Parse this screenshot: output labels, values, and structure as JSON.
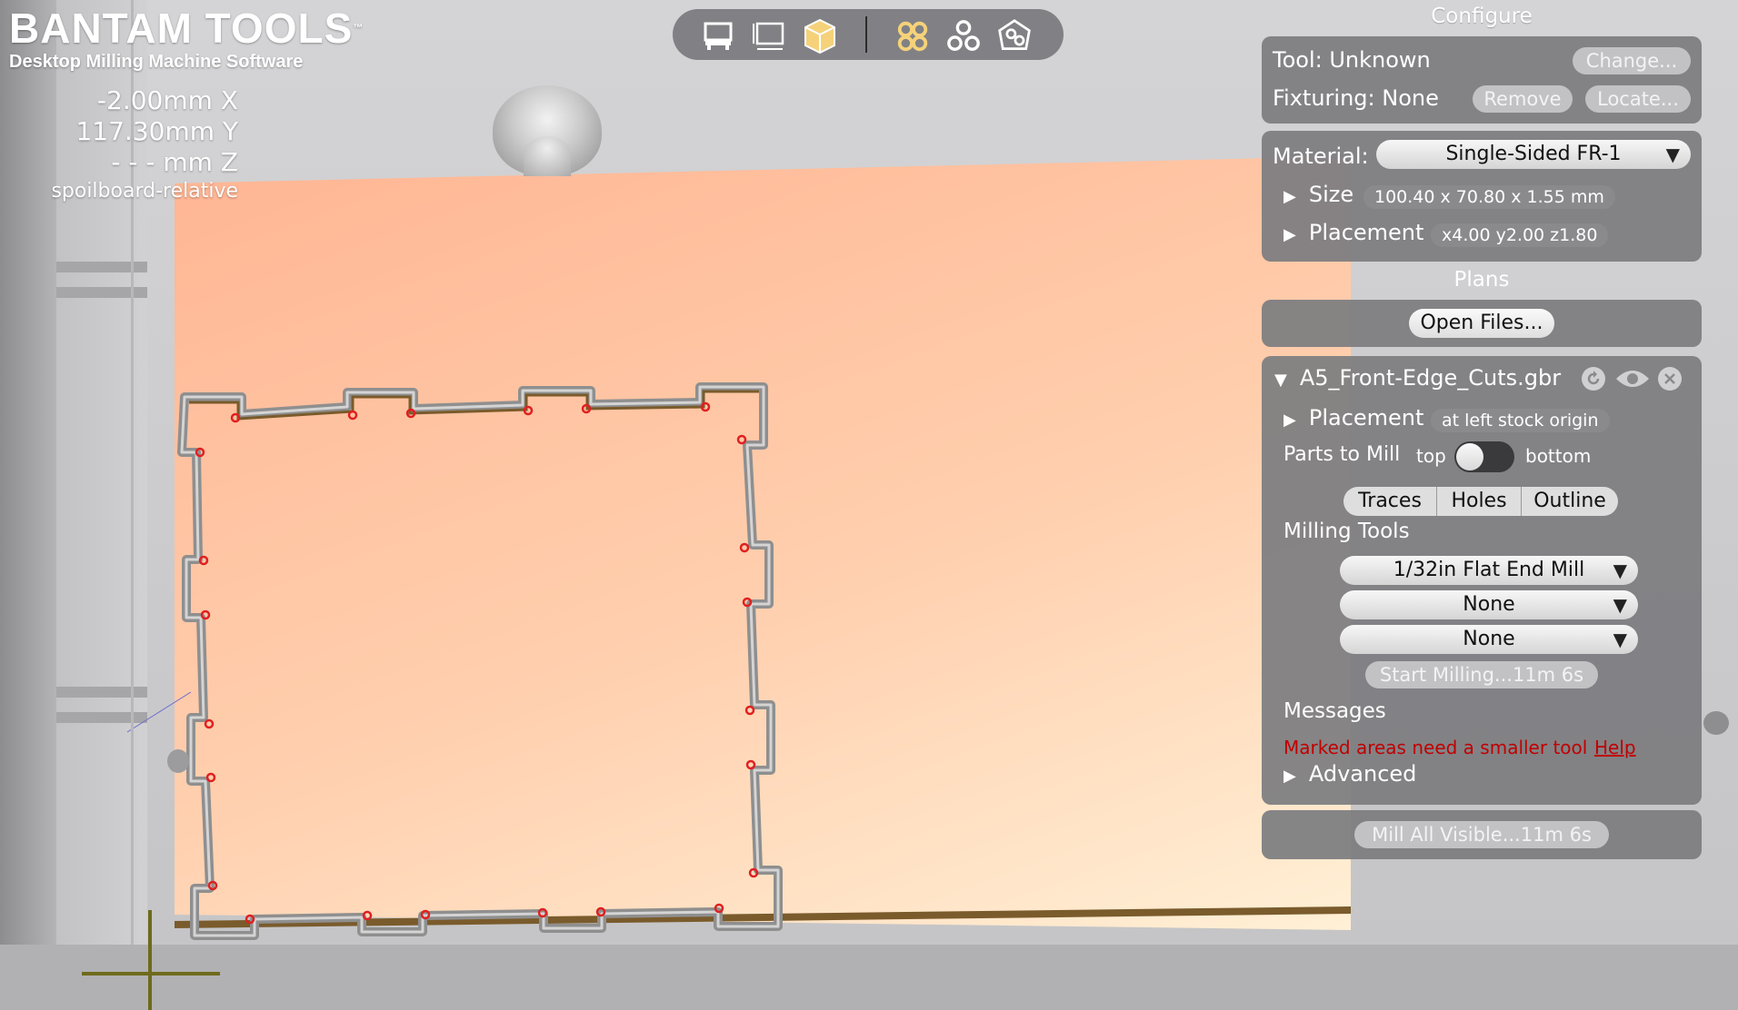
{
  "brand": {
    "title": "BANTAM TOOLS",
    "trademark": "™",
    "subtitle": "Desktop Milling Machine Software"
  },
  "coordinates": {
    "x": "-2.00mm X",
    "y": "117.30mm Y",
    "z": "- - - mm Z",
    "reference": "spoilboard-relative"
  },
  "toolbar": {
    "icons": [
      "machine-view-icon",
      "stock-dimensions-icon",
      "3d-box-view-icon",
      "traces-view-icon",
      "holes-view-icon",
      "board-view-icon"
    ],
    "active_icon_color": "#f5d27a"
  },
  "configure": {
    "title": "Configure",
    "tool_label": "Tool: Unknown",
    "change_button": "Change...",
    "fixturing_label": "Fixturing: None",
    "remove_button": "Remove",
    "locate_button": "Locate...",
    "material_label": "Material:",
    "material_value": "Single-Sided FR-1",
    "size_label": "Size",
    "size_value": "100.40 x 70.80 x 1.55 mm",
    "placement_label": "Placement",
    "placement_value": "x4.00 y2.00 z1.80"
  },
  "plans": {
    "title": "Plans",
    "open_files_button": "Open Files...",
    "file_name": "A5_Front-Edge_Cuts.gbr",
    "placement_label": "Placement",
    "placement_value": "at left stock origin",
    "parts_to_mill_label": "Parts to Mill",
    "toggle_left": "top",
    "toggle_right": "bottom",
    "tabs": [
      "Traces",
      "Holes",
      "Outline"
    ],
    "milling_tools_label": "Milling Tools",
    "tool_selects": [
      "1/32in Flat End Mill",
      "None",
      "None"
    ],
    "start_milling_button": "Start Milling...11m 6s",
    "messages_label": "Messages",
    "message_text": "Marked areas need a smaller tool",
    "message_link": "Help",
    "advanced_label": "Advanced",
    "mill_all_button": "Mill All Visible...11m 6s"
  },
  "colors": {
    "panel_bg": "#7d7d80",
    "stock_top": "#ffb593",
    "stock_bottom": "#fff0d6",
    "error_red": "#c00000",
    "outline_brown": "#7a5b2c"
  }
}
